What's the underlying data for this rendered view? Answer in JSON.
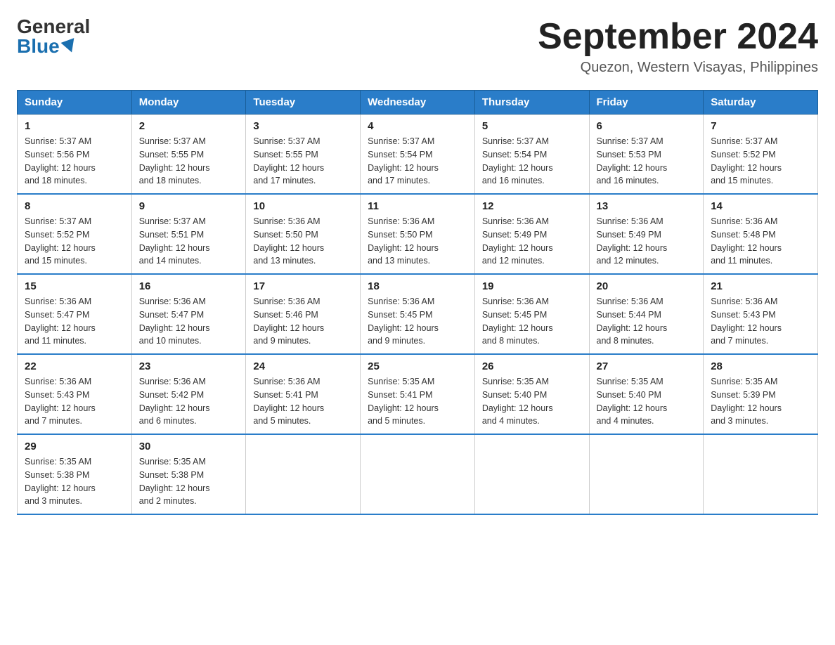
{
  "header": {
    "logo_general": "General",
    "logo_blue": "Blue",
    "month": "September 2024",
    "location": "Quezon, Western Visayas, Philippines"
  },
  "days_of_week": [
    "Sunday",
    "Monday",
    "Tuesday",
    "Wednesday",
    "Thursday",
    "Friday",
    "Saturday"
  ],
  "weeks": [
    [
      {
        "day": "1",
        "sunrise": "5:37 AM",
        "sunset": "5:56 PM",
        "daylight": "12 hours and 18 minutes."
      },
      {
        "day": "2",
        "sunrise": "5:37 AM",
        "sunset": "5:55 PM",
        "daylight": "12 hours and 18 minutes."
      },
      {
        "day": "3",
        "sunrise": "5:37 AM",
        "sunset": "5:55 PM",
        "daylight": "12 hours and 17 minutes."
      },
      {
        "day": "4",
        "sunrise": "5:37 AM",
        "sunset": "5:54 PM",
        "daylight": "12 hours and 17 minutes."
      },
      {
        "day": "5",
        "sunrise": "5:37 AM",
        "sunset": "5:54 PM",
        "daylight": "12 hours and 16 minutes."
      },
      {
        "day": "6",
        "sunrise": "5:37 AM",
        "sunset": "5:53 PM",
        "daylight": "12 hours and 16 minutes."
      },
      {
        "day": "7",
        "sunrise": "5:37 AM",
        "sunset": "5:52 PM",
        "daylight": "12 hours and 15 minutes."
      }
    ],
    [
      {
        "day": "8",
        "sunrise": "5:37 AM",
        "sunset": "5:52 PM",
        "daylight": "12 hours and 15 minutes."
      },
      {
        "day": "9",
        "sunrise": "5:37 AM",
        "sunset": "5:51 PM",
        "daylight": "12 hours and 14 minutes."
      },
      {
        "day": "10",
        "sunrise": "5:36 AM",
        "sunset": "5:50 PM",
        "daylight": "12 hours and 13 minutes."
      },
      {
        "day": "11",
        "sunrise": "5:36 AM",
        "sunset": "5:50 PM",
        "daylight": "12 hours and 13 minutes."
      },
      {
        "day": "12",
        "sunrise": "5:36 AM",
        "sunset": "5:49 PM",
        "daylight": "12 hours and 12 minutes."
      },
      {
        "day": "13",
        "sunrise": "5:36 AM",
        "sunset": "5:49 PM",
        "daylight": "12 hours and 12 minutes."
      },
      {
        "day": "14",
        "sunrise": "5:36 AM",
        "sunset": "5:48 PM",
        "daylight": "12 hours and 11 minutes."
      }
    ],
    [
      {
        "day": "15",
        "sunrise": "5:36 AM",
        "sunset": "5:47 PM",
        "daylight": "12 hours and 11 minutes."
      },
      {
        "day": "16",
        "sunrise": "5:36 AM",
        "sunset": "5:47 PM",
        "daylight": "12 hours and 10 minutes."
      },
      {
        "day": "17",
        "sunrise": "5:36 AM",
        "sunset": "5:46 PM",
        "daylight": "12 hours and 9 minutes."
      },
      {
        "day": "18",
        "sunrise": "5:36 AM",
        "sunset": "5:45 PM",
        "daylight": "12 hours and 9 minutes."
      },
      {
        "day": "19",
        "sunrise": "5:36 AM",
        "sunset": "5:45 PM",
        "daylight": "12 hours and 8 minutes."
      },
      {
        "day": "20",
        "sunrise": "5:36 AM",
        "sunset": "5:44 PM",
        "daylight": "12 hours and 8 minutes."
      },
      {
        "day": "21",
        "sunrise": "5:36 AM",
        "sunset": "5:43 PM",
        "daylight": "12 hours and 7 minutes."
      }
    ],
    [
      {
        "day": "22",
        "sunrise": "5:36 AM",
        "sunset": "5:43 PM",
        "daylight": "12 hours and 7 minutes."
      },
      {
        "day": "23",
        "sunrise": "5:36 AM",
        "sunset": "5:42 PM",
        "daylight": "12 hours and 6 minutes."
      },
      {
        "day": "24",
        "sunrise": "5:36 AM",
        "sunset": "5:41 PM",
        "daylight": "12 hours and 5 minutes."
      },
      {
        "day": "25",
        "sunrise": "5:35 AM",
        "sunset": "5:41 PM",
        "daylight": "12 hours and 5 minutes."
      },
      {
        "day": "26",
        "sunrise": "5:35 AM",
        "sunset": "5:40 PM",
        "daylight": "12 hours and 4 minutes."
      },
      {
        "day": "27",
        "sunrise": "5:35 AM",
        "sunset": "5:40 PM",
        "daylight": "12 hours and 4 minutes."
      },
      {
        "day": "28",
        "sunrise": "5:35 AM",
        "sunset": "5:39 PM",
        "daylight": "12 hours and 3 minutes."
      }
    ],
    [
      {
        "day": "29",
        "sunrise": "5:35 AM",
        "sunset": "5:38 PM",
        "daylight": "12 hours and 3 minutes."
      },
      {
        "day": "30",
        "sunrise": "5:35 AM",
        "sunset": "5:38 PM",
        "daylight": "12 hours and 2 minutes."
      },
      null,
      null,
      null,
      null,
      null
    ]
  ]
}
